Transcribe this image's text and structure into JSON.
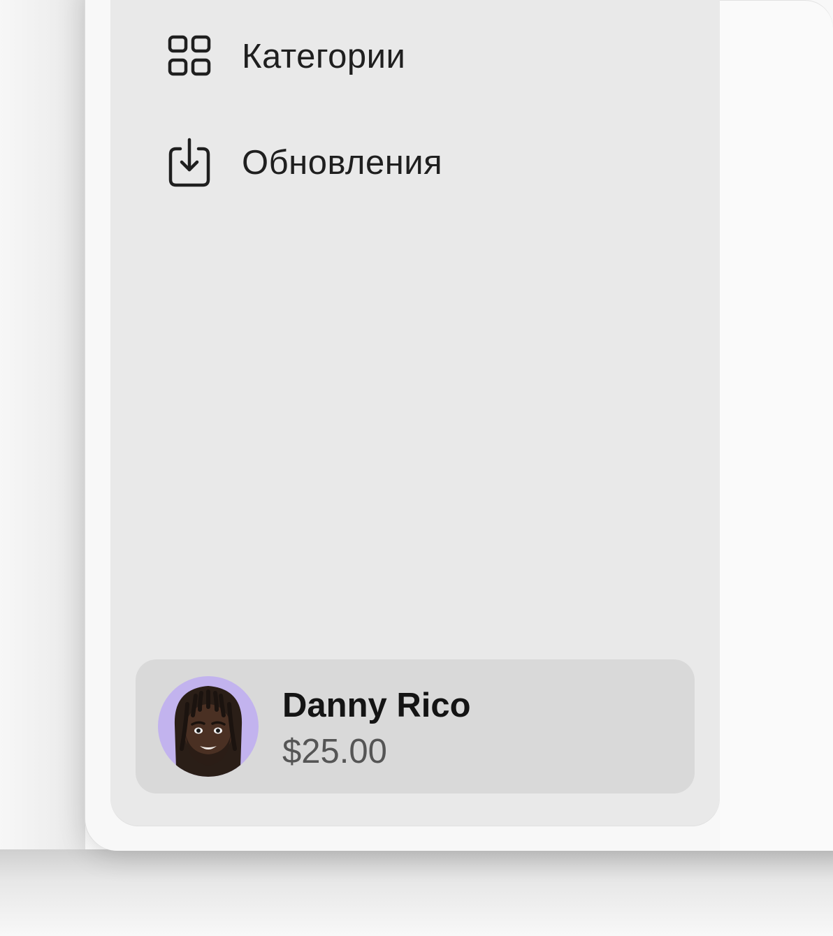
{
  "sidebar": {
    "items": [
      {
        "label": "Категории",
        "icon": "grid-icon"
      },
      {
        "label": "Обновления",
        "icon": "download-tray-icon"
      }
    ]
  },
  "account": {
    "name": "Danny Rico",
    "balance": "$25.00",
    "avatar": "memoji-avatar"
  },
  "colors": {
    "sidebar_bg": "#e9e9e9",
    "account_bg": "#d9d9d9",
    "avatar_bg": "#c2b3ee",
    "text_primary": "#1f1f1f",
    "text_secondary": "#555555"
  }
}
